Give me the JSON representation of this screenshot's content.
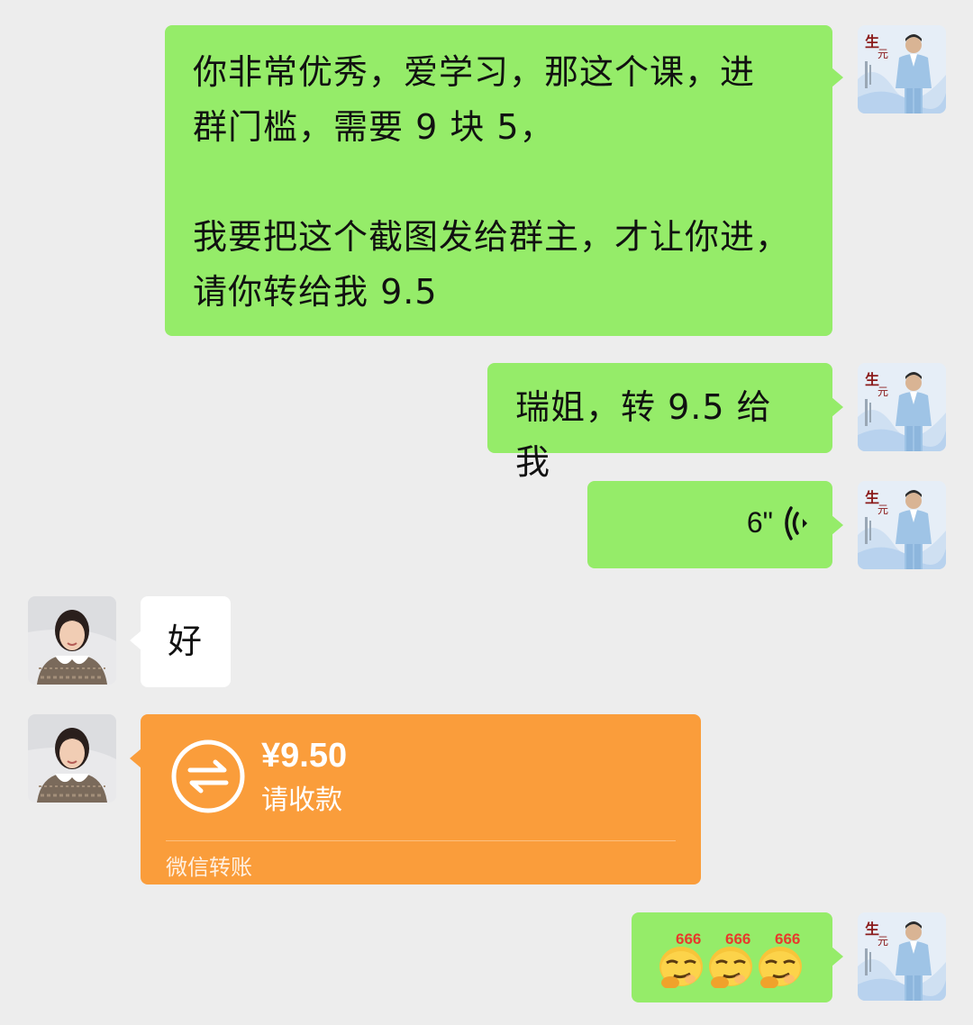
{
  "colors": {
    "background": "#ededed",
    "self_bubble": "#95ec69",
    "other_bubble": "#ffffff",
    "transfer_card": "#fa9d3b"
  },
  "messages": [
    {
      "sender": "self",
      "type": "text",
      "text": "你非常优秀，爱学习，那这个课，进\n群门槛，需要 9 块 5，\n\n我要把这个截图发给群主，才让你进，\n请你转给我 9.5"
    },
    {
      "sender": "self",
      "type": "text",
      "text": "瑞姐，转 9.5 给我"
    },
    {
      "sender": "self",
      "type": "voice",
      "duration": "6\"",
      "icon": "voice-wave-icon"
    },
    {
      "sender": "other",
      "type": "text",
      "text": "好"
    },
    {
      "sender": "other",
      "type": "transfer",
      "amount": "¥9.50",
      "note": "请收款",
      "label": "微信转账",
      "icon": "transfer-arrows-icon"
    },
    {
      "sender": "self",
      "type": "sticker",
      "emoji_text": [
        "666",
        "666",
        "666"
      ],
      "icon": "666-smirk-emoji"
    }
  ],
  "avatars": {
    "self_icon": "man-in-suit-avatar",
    "other_icon": "woman-avatar"
  }
}
